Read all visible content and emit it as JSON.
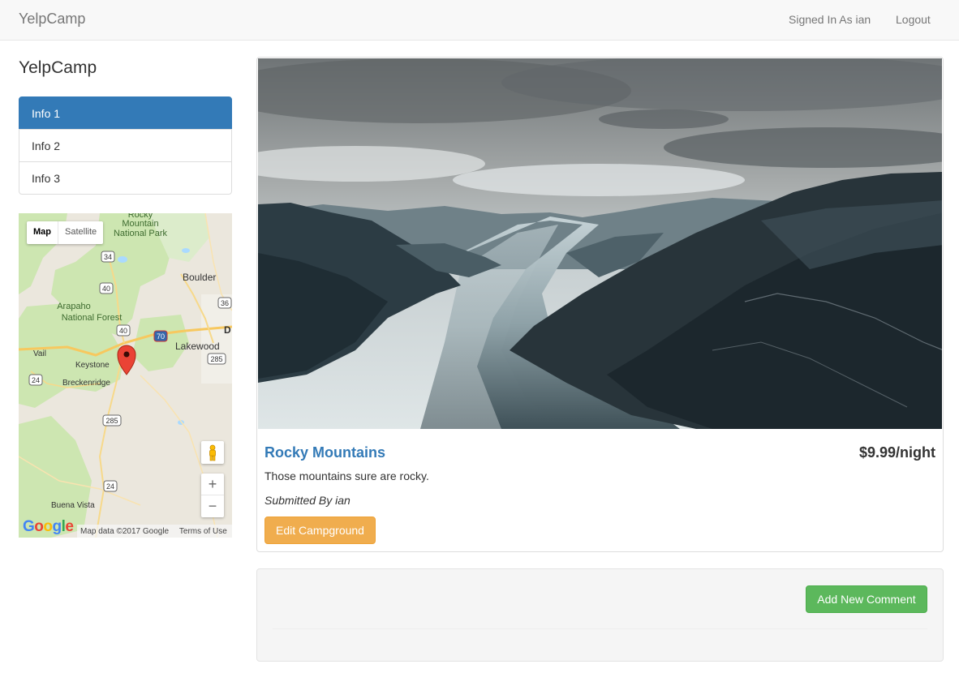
{
  "navbar": {
    "brand": "YelpCamp",
    "signed_in": "Signed In As ian",
    "logout": "Logout"
  },
  "sidebar": {
    "lead": "YelpCamp",
    "items": [
      {
        "label": "Info 1",
        "active": true
      },
      {
        "label": "Info 2",
        "active": false
      },
      {
        "label": "Info 3",
        "active": false
      }
    ]
  },
  "map": {
    "type_map": "Map",
    "type_satellite": "Satellite",
    "labels": {
      "rmnp": "Rocky",
      "rmnp2": "Mountain",
      "rmnp3": "National Park",
      "boulder": "Boulder",
      "arapaho": "Arapaho",
      "arapaho2": "National Forest",
      "lakewood": "Lakewood",
      "vail": "Vail",
      "keystone": "Keystone",
      "breckenridge": "Breckenridge",
      "buena_vista": "Buena Vista",
      "denver_initial": "D"
    },
    "shields": [
      "34",
      "40",
      "40",
      "70",
      "36",
      "285",
      "24",
      "285",
      "24"
    ],
    "zoom_in": "+",
    "zoom_out": "−",
    "google": "Google",
    "attribution": "Map data ©2017 Google",
    "terms": "Terms of Use"
  },
  "campground": {
    "name": "Rocky Mountains",
    "price": "$9.99/night",
    "description": "Those mountains sure are rocky.",
    "author": "Submitted By ian",
    "edit_label": "Edit Campground"
  },
  "comments": {
    "add_label": "Add New Comment"
  },
  "colors": {
    "primary": "#337ab7",
    "warning": "#f0ad4e",
    "success": "#5cb85c",
    "navbar_bg": "#f8f8f8"
  }
}
